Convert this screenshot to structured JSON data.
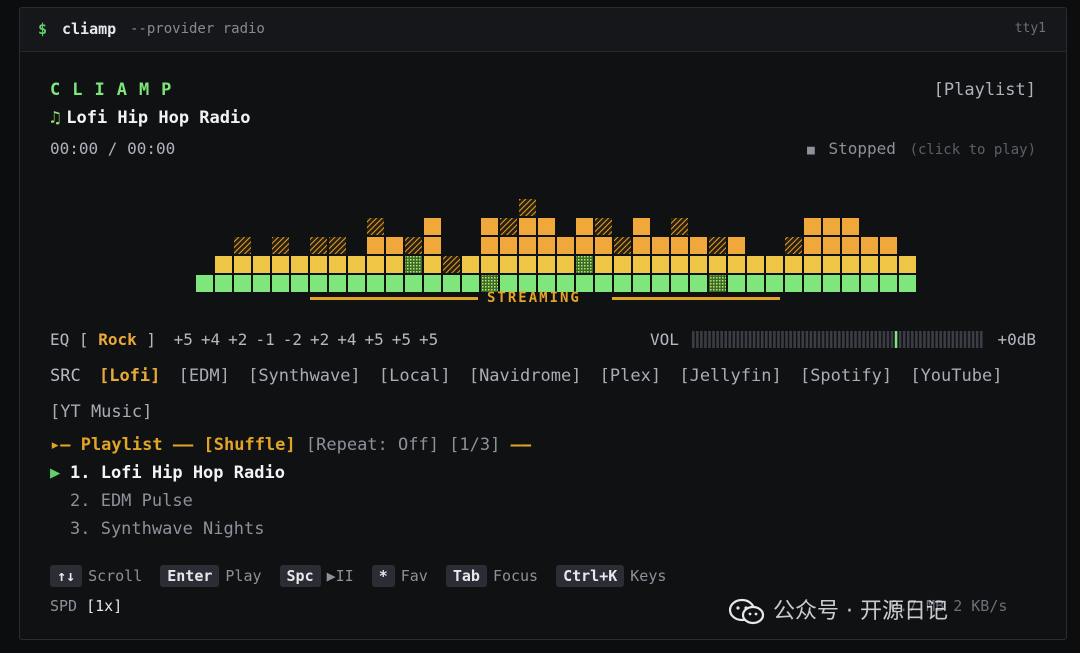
{
  "titlebar": {
    "prompt": "$",
    "command": "cliamp",
    "args": "--provider radio",
    "tty": "tty1"
  },
  "player": {
    "brand": "CLIAMP",
    "track_note": "♫",
    "track_title": "Lofi Hip Hop Radio",
    "time": "00:00 / 00:00",
    "playlist_tag": "[Playlist]",
    "status_icon": "■",
    "status": "Stopped",
    "status_hint": "(click to play)"
  },
  "visualizer": {
    "label": "STREAMING",
    "colors": {
      "green": "#7ee67a",
      "yellow": "#eec544",
      "orange": "#f0a83a",
      "red": "#e8654a",
      "accent": "#e2a426"
    },
    "columns": [
      {
        "h": 1
      },
      {
        "h": 2
      },
      {
        "h": 3,
        "hatch": true
      },
      {
        "h": 2
      },
      {
        "h": 3,
        "hatch": true
      },
      {
        "h": 2
      },
      {
        "h": 3,
        "hatch": true
      },
      {
        "h": 3,
        "hatch": true
      },
      {
        "h": 2
      },
      {
        "h": 4,
        "hatch": true
      },
      {
        "h": 3
      },
      {
        "h": 3,
        "hatch": true
      },
      {
        "h": 4
      },
      {
        "h": 2,
        "hatch": true
      },
      {
        "h": 2
      },
      {
        "h": 4
      },
      {
        "h": 4,
        "hatch": true
      },
      {
        "h": 5,
        "hatch": true
      },
      {
        "h": 4
      },
      {
        "h": 3
      },
      {
        "h": 4
      },
      {
        "h": 4,
        "hatch": true
      },
      {
        "h": 3,
        "hatch": true
      },
      {
        "h": 4
      },
      {
        "h": 3
      },
      {
        "h": 4,
        "hatch": true
      },
      {
        "h": 3
      },
      {
        "h": 3,
        "hatch": true
      },
      {
        "h": 3
      },
      {
        "h": 2
      },
      {
        "h": 2
      },
      {
        "h": 3,
        "hatch": true
      },
      {
        "h": 4
      },
      {
        "h": 4
      },
      {
        "h": 4
      },
      {
        "h": 3
      },
      {
        "h": 3
      },
      {
        "h": 2
      }
    ]
  },
  "eq": {
    "label": "EQ",
    "open": "[",
    "preset": "Rock",
    "close": "]",
    "bands": [
      "+5",
      "+4",
      "+2",
      "-1",
      "-2",
      "+2",
      "+4",
      "+5",
      "+5",
      "+5"
    ]
  },
  "volume": {
    "label": "VOL",
    "level_fraction": 0.69,
    "db": "+0dB"
  },
  "sources": {
    "label": "SRC",
    "items": [
      {
        "label": "[Lofi]",
        "active": true
      },
      {
        "label": "[EDM]",
        "active": false
      },
      {
        "label": "[Synthwave]",
        "active": false
      },
      {
        "label": "[Local]",
        "active": false
      },
      {
        "label": "[Navidrome]",
        "active": false
      },
      {
        "label": "[Plex]",
        "active": false
      },
      {
        "label": "[Jellyfin]",
        "active": false
      },
      {
        "label": "[Spotify]",
        "active": false
      },
      {
        "label": "[YouTube]",
        "active": false
      },
      {
        "label": "[YT Music]",
        "active": false
      }
    ]
  },
  "playlist": {
    "header_start": "▸— Playlist —— [Shuffle]",
    "header_repeat": "[Repeat: Off] [1/3]",
    "header_end": "——",
    "current_marker": "▶",
    "items": [
      {
        "label": "1. Lofi Hip Hop Radio"
      },
      {
        "label": "2. EDM Pulse"
      },
      {
        "label": "3. Synthwave Nights"
      }
    ]
  },
  "keys": [
    {
      "key": "↑↓",
      "action": "Scroll"
    },
    {
      "key": "Enter",
      "action": "Play"
    },
    {
      "key": "Spc",
      "action": "▶II"
    },
    {
      "key": "*",
      "action": "Fav"
    },
    {
      "key": "Tab",
      "action": "Focus"
    },
    {
      "key": "Ctrl+K",
      "action": "Keys"
    }
  ],
  "speed": {
    "label": "SPD",
    "value": "[1x]"
  },
  "stats": "0.7 MB  2 KB/s",
  "watermark": "公众号 · 开源日记"
}
